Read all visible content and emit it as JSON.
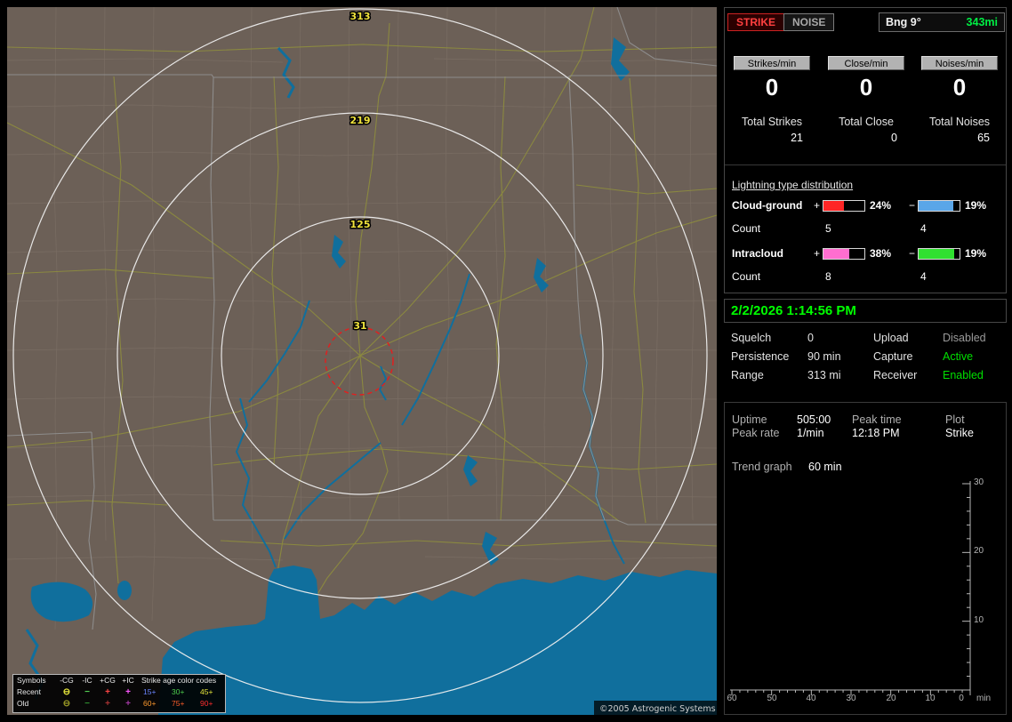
{
  "map": {
    "ring_labels": [
      "313",
      "219",
      "125",
      "31"
    ],
    "copyright": "©2005 Astrogenic Systems",
    "legend": {
      "symbols_header": "Symbols",
      "type_headers": [
        "-CG",
        "-IC",
        "+CG",
        "+IC"
      ],
      "age_header": "Strike age color codes",
      "recent_label": "Recent",
      "old_label": "Old",
      "glyphs": [
        "⊖",
        "−",
        "+",
        "+"
      ],
      "recent_ages": [
        "15+",
        "30+",
        "45+"
      ],
      "old_ages": [
        "60+",
        "75+",
        "90+"
      ]
    }
  },
  "sidebar": {
    "strike_button": "STRIKE",
    "noise_button": "NOISE",
    "bearing": {
      "label": "Bng 9°",
      "distance": "343mi"
    },
    "rates": [
      {
        "label": "Strikes/min",
        "value": "0"
      },
      {
        "label": "Close/min",
        "value": "0"
      },
      {
        "label": "Noises/min",
        "value": "0"
      }
    ],
    "totals": [
      {
        "label": "Total Strikes",
        "value": "21"
      },
      {
        "label": "Total Close",
        "value": "0"
      },
      {
        "label": "Total Noises",
        "value": "65"
      }
    ],
    "distribution": {
      "header": "Lightning type distribution",
      "count_label": "Count",
      "plus_sign": "+",
      "minus_sign": "−",
      "rows": [
        {
          "label": "Cloud-ground",
          "pos_pct": "24%",
          "neg_pct": "19%",
          "pos_count": "5",
          "neg_count": "4",
          "pos_fill": 50,
          "neg_fill": 85,
          "pos_color": "#ff2626",
          "neg_color": "#5aa6e8"
        },
        {
          "label": "Intracloud",
          "pos_pct": "38%",
          "neg_pct": "19%",
          "pos_count": "8",
          "neg_count": "4",
          "pos_fill": 62,
          "neg_fill": 88,
          "pos_color": "#ff6ed0",
          "neg_color": "#30e030"
        }
      ]
    },
    "datetime": "2/2/2026 1:14:56 PM",
    "settings": {
      "rows": [
        {
          "l1": "Squelch",
          "v1": "0",
          "l2": "Upload",
          "v2": "Disabled"
        },
        {
          "l1": "Persistence",
          "v1": "90 min",
          "l2": "Capture",
          "v2": "Active"
        },
        {
          "l1": "Range",
          "v1": "313 mi",
          "l2": "Receiver",
          "v2": "Enabled"
        }
      ]
    },
    "status": {
      "uptime_label": "Uptime",
      "uptime_value": "505:00",
      "peak_time_label": "Peak time",
      "peak_time_value": "12:18 PM",
      "plot_label": "Plot",
      "plot_value": "Strike",
      "peak_rate_label": "Peak rate",
      "peak_rate_value": "1/min",
      "trend_label": "Trend graph",
      "trend_value": "60 min"
    }
  },
  "chart_data": {
    "type": "line",
    "title": "Trend graph",
    "window_label": "60 min",
    "xlabel_unit": "min",
    "x_ticks": [
      "60",
      "50",
      "40",
      "30",
      "20",
      "10",
      "0"
    ],
    "y_ticks": [
      "30",
      "20",
      "10"
    ],
    "xlim": [
      60,
      0
    ],
    "ylim": [
      0,
      30
    ],
    "grid": false,
    "legend": "none",
    "series": []
  },
  "colors": {
    "strike_accent": "#ff4040",
    "active_green": "#00e000",
    "disabled_gray": "#9a9a9a",
    "datetime_green": "#00ff00",
    "ring_label_yellow": "#efe23c",
    "map_land": "#6c6057",
    "map_water": "#106f9d",
    "map_road": "#90903c",
    "age_recent": [
      "#6c86ff",
      "#4ece4e",
      "#e6e63c"
    ],
    "age_old": [
      "#ff9a2e",
      "#ff5e2a",
      "#ff2e2e"
    ],
    "glyph_recent": [
      "#e6e63c",
      "#55d455",
      "#ff4545",
      "#ff57ff"
    ],
    "glyph_old": [
      "#9a9a26",
      "#2f8f2f",
      "#aa3333",
      "#a338a3"
    ]
  }
}
